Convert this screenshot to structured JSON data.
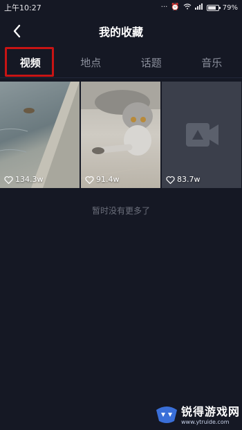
{
  "status_bar": {
    "time": "上午10:27",
    "battery": "79%",
    "battery_level": 0.79,
    "icons": [
      "signal-dots-icon",
      "alarm-icon",
      "wifi-icon",
      "signal-icon",
      "battery-icon"
    ]
  },
  "header": {
    "title": "我的收藏",
    "back_icon": "chevron-left-icon"
  },
  "tabs": [
    {
      "label": "视频",
      "active": true
    },
    {
      "label": "地点",
      "active": false
    },
    {
      "label": "话题",
      "active": false
    },
    {
      "label": "音乐",
      "active": false
    }
  ],
  "videos": [
    {
      "likes": "134.3w",
      "thumbnail": "water-bank-scene"
    },
    {
      "likes": "91.4w",
      "thumbnail": "cat-with-mouse-scene"
    },
    {
      "likes": "83.7w",
      "thumbnail": "video-placeholder-icon"
    }
  ],
  "empty_message": "暂时没有更多了",
  "watermark": {
    "text": "锐得游戏网",
    "url": "www.ytruide.com"
  },
  "colors": {
    "background": "#151824",
    "highlight_border": "#c81414",
    "tab_active": "#ffffff",
    "tab_inactive": "#8b8f9c"
  }
}
